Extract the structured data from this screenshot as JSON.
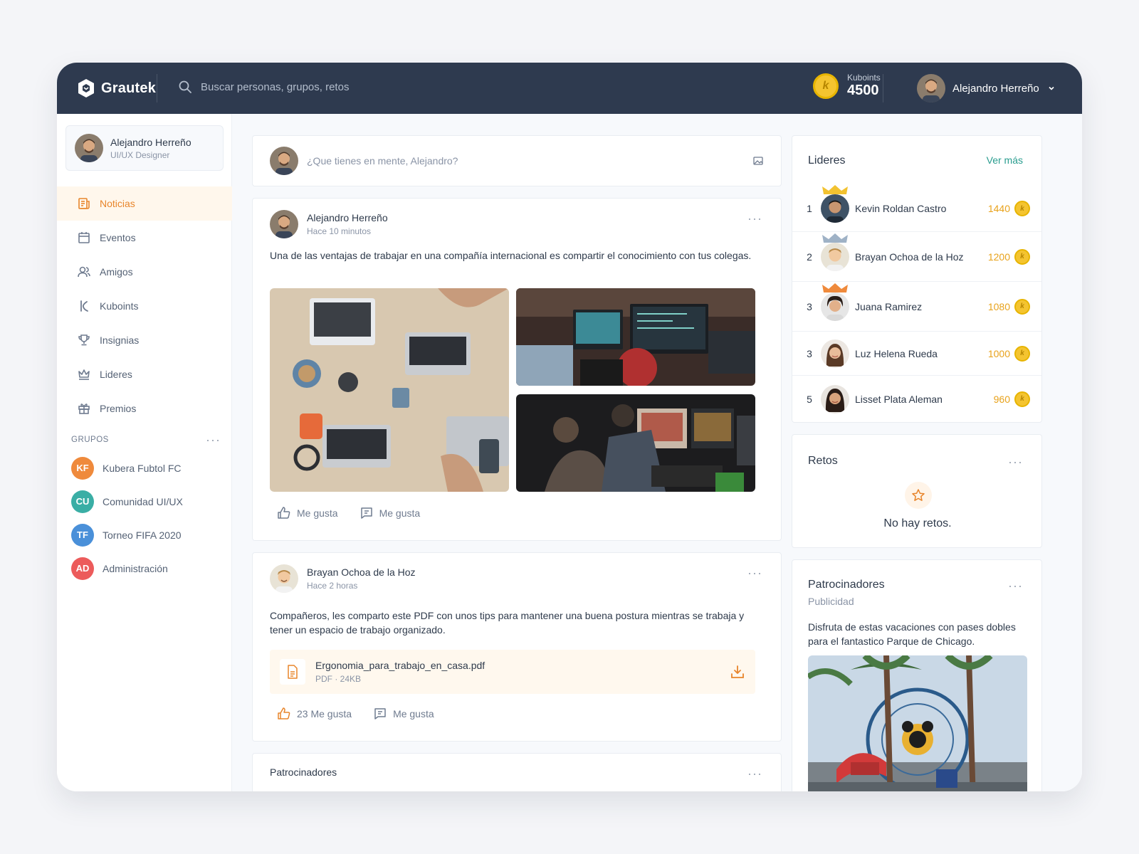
{
  "header": {
    "brand": "Grautek",
    "search_placeholder": "Buscar personas, grupos, retos",
    "kuboints_label": "Kuboints",
    "kuboints_value": "4500",
    "user_name": "Alejandro Herreño"
  },
  "sidebar": {
    "profile": {
      "name": "Alejandro Herreño",
      "role": "UI/UX Designer"
    },
    "nav": [
      {
        "label": "Noticias",
        "icon": "newspaper-icon",
        "active": true
      },
      {
        "label": "Eventos",
        "icon": "calendar-icon"
      },
      {
        "label": "Amigos",
        "icon": "users-icon"
      },
      {
        "label": "Kuboints",
        "icon": "kuboints-icon"
      },
      {
        "label": "Insignias",
        "icon": "trophy-icon"
      },
      {
        "label": "Lideres",
        "icon": "crown-icon"
      },
      {
        "label": "Premios",
        "icon": "gift-icon"
      }
    ],
    "groups_title": "GRUPOS",
    "groups": [
      {
        "initials": "KF",
        "name": "Kubera Fubtol FC",
        "color": "#ef8a3c"
      },
      {
        "initials": "CU",
        "name": "Comunidad UI/UX",
        "color": "#3aaea5"
      },
      {
        "initials": "TF",
        "name": "Torneo FIFA 2020",
        "color": "#4a90d9"
      },
      {
        "initials": "AD",
        "name": "Administración",
        "color": "#ec5b5b"
      }
    ]
  },
  "composer": {
    "placeholder": "¿Que tienes en mente, Alejandro?"
  },
  "posts": [
    {
      "author": "Alejandro Herreño",
      "time": "Hace 10 minutos",
      "text": "Una de las ventajas de trabajar en una compañía internacional es compartir el conocimiento con tus colegas.",
      "like_label": "Me gusta",
      "comment_label": "Me gusta"
    },
    {
      "author": "Brayan Ochoa de la Hoz",
      "time": "Hace 2 horas",
      "text": "Compañeros, les comparto este PDF con unos tips para mantener una buena postura mientras se trabaja y tener un espacio de trabajo organizado.",
      "file_name": "Ergonomia_para_trabajo_en_casa.pdf",
      "file_meta": "PDF · 24KB",
      "like_label": "23 Me gusta",
      "comment_label": "Me gusta"
    },
    {
      "author": "Patrocinadores"
    }
  ],
  "leaders": {
    "title": "Lideres",
    "see_more": "Ver más",
    "rows": [
      {
        "rank": "1",
        "name": "Kevin Roldan Castro",
        "points": "1440",
        "crown": "#f2c230"
      },
      {
        "rank": "2",
        "name": "Brayan Ochoa de la Hoz",
        "points": "1200",
        "crown": "#9fb2c6"
      },
      {
        "rank": "3",
        "name": "Juana Ramirez",
        "points": "1080",
        "crown": "#ef8a3c"
      },
      {
        "rank": "3",
        "name": "Luz Helena Rueda",
        "points": "1000"
      },
      {
        "rank": "5",
        "name": "Lisset Plata Aleman",
        "points": "960"
      }
    ]
  },
  "challenges": {
    "title": "Retos",
    "empty": "No hay retos."
  },
  "sponsors": {
    "title": "Patrocinadores",
    "subtitle": "Publicidad",
    "text": "Disfruta de estas vacaciones con pases dobles para el fantastico Parque de Chicago."
  }
}
